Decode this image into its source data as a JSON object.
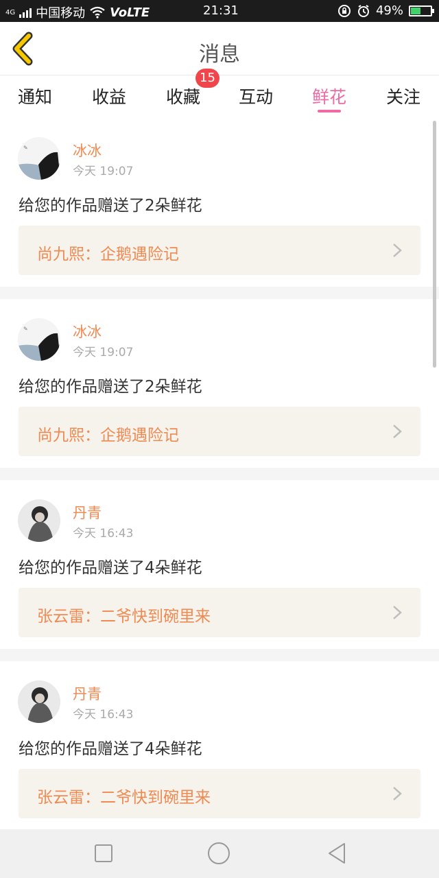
{
  "status_bar": {
    "carrier": "中国移动",
    "network": "VoLTE",
    "time": "21:31",
    "battery": "49%",
    "battery_level": 0.49,
    "signal_label": "4G"
  },
  "header": {
    "title": "消息"
  },
  "tabs": [
    {
      "label": "通知",
      "active": false
    },
    {
      "label": "收益",
      "active": false
    },
    {
      "label": "收藏",
      "active": false
    },
    {
      "label": "互动",
      "active": false
    },
    {
      "label": "鲜花",
      "active": true
    },
    {
      "label": "关注",
      "active": false
    }
  ],
  "badge": {
    "count": "15"
  },
  "messages": [
    {
      "user": "冰冰",
      "time": "今天 19:07",
      "text": "给您的作品赠送了2朵鲜花",
      "work": "尚九熙：企鹅遇险记"
    },
    {
      "user": "冰冰",
      "time": "今天 19:07",
      "text": "给您的作品赠送了2朵鲜花",
      "work": "尚九熙：企鹅遇险记"
    },
    {
      "user": "丹青",
      "time": "今天 16:43",
      "text": "给您的作品赠送了4朵鲜花",
      "work": "张云雷：二爷快到碗里来"
    },
    {
      "user": "丹青",
      "time": "今天 16:43",
      "text": "给您的作品赠送了4朵鲜花",
      "work": "张云雷：二爷快到碗里来"
    }
  ],
  "colors": {
    "accent": "#f06aa3",
    "name": "#f08a52",
    "badge": "#f0454a",
    "back_arrow": "#f5c800"
  },
  "icons": {
    "back": "back-arrow-icon",
    "chevron": "chevron-right-icon",
    "nav_recent": "square-icon",
    "nav_home": "circle-icon",
    "nav_back": "triangle-back-icon"
  }
}
